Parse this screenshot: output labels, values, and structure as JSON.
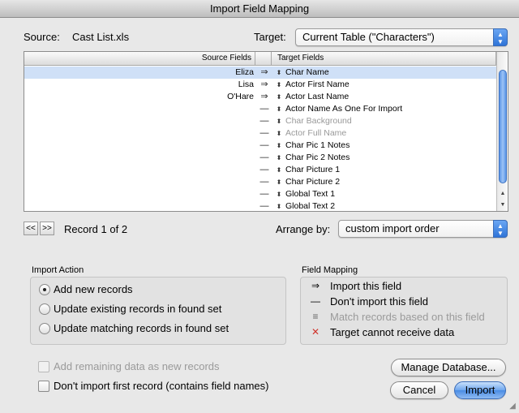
{
  "window": {
    "title": "Import Field Mapping"
  },
  "source": {
    "label": "Source:",
    "value": "Cast List.xls"
  },
  "target": {
    "label": "Target:",
    "value": "Current Table (\"Characters\")"
  },
  "table": {
    "headers": {
      "source": "Source Fields",
      "target": "Target Fields"
    },
    "rows": [
      {
        "source": "Eliza",
        "mapping": "⇒",
        "target": "Char Name",
        "selected": true,
        "dim": false
      },
      {
        "source": "Lisa",
        "mapping": "⇒",
        "target": "Actor First Name",
        "dim": false
      },
      {
        "source": "O'Hare",
        "mapping": "⇒",
        "target": "Actor Last Name",
        "dim": false
      },
      {
        "source": "",
        "mapping": "—",
        "target": "Actor Name As One For Import",
        "dim": false
      },
      {
        "source": "",
        "mapping": "—",
        "target": "Char Background",
        "dim": true
      },
      {
        "source": "",
        "mapping": "—",
        "target": "Actor Full Name",
        "dim": true
      },
      {
        "source": "",
        "mapping": "—",
        "target": "Char Pic 1 Notes",
        "dim": false
      },
      {
        "source": "",
        "mapping": "—",
        "target": "Char Pic 2 Notes",
        "dim": false
      },
      {
        "source": "",
        "mapping": "—",
        "target": "Char Picture 1",
        "dim": false
      },
      {
        "source": "",
        "mapping": "—",
        "target": "Char Picture 2",
        "dim": false
      },
      {
        "source": "",
        "mapping": "—",
        "target": "Global Text 1",
        "dim": false
      },
      {
        "source": "",
        "mapping": "—",
        "target": "Global Text 2",
        "dim": false
      }
    ]
  },
  "record_nav": {
    "prev": "<<",
    "next": ">>",
    "status": "Record 1 of 2"
  },
  "arrange": {
    "label": "Arrange by:",
    "value": "custom import order"
  },
  "import_action": {
    "title": "Import Action",
    "options": [
      {
        "label": "Add new records",
        "selected": true
      },
      {
        "label": "Update existing records in found set",
        "selected": false
      },
      {
        "label": "Update matching records in found set",
        "selected": false
      }
    ]
  },
  "field_mapping": {
    "title": "Field Mapping",
    "items": [
      {
        "symbol": "⇒",
        "label": "Import this field",
        "dim": false,
        "color": "#000000"
      },
      {
        "symbol": "—",
        "label": "Don't import this field",
        "dim": false,
        "color": "#000000"
      },
      {
        "symbol": "≡",
        "label": "Match records based on this field",
        "dim": true,
        "color": "#666666"
      },
      {
        "symbol": "✕",
        "label": "Target cannot receive data",
        "dim": false,
        "color": "#d0342c"
      }
    ]
  },
  "options": {
    "add_remaining": {
      "label": "Add remaining data as new records",
      "checked": false,
      "disabled": true
    },
    "skip_first": {
      "label": "Don't import first record (contains field names)",
      "checked": false,
      "disabled": false
    }
  },
  "buttons": {
    "manage": "Manage Database...",
    "cancel": "Cancel",
    "import": "Import"
  },
  "colors": {
    "accent": "#3a6cb8",
    "selection": "#cfe0f7",
    "error_red": "#d0342c"
  }
}
